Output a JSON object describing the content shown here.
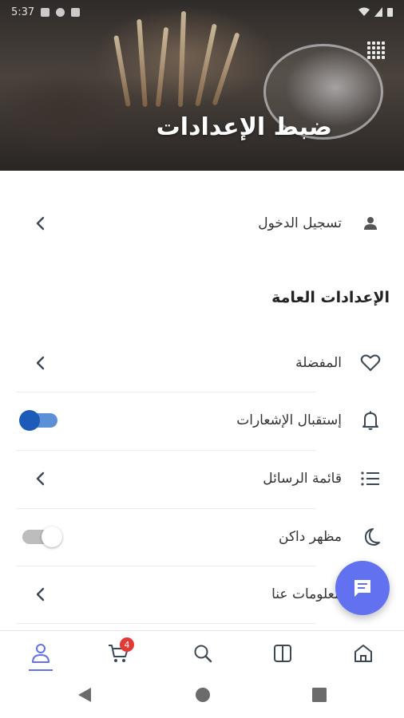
{
  "status_bar": {
    "time": "5:37"
  },
  "header": {
    "title": "ضبط الإعدادات"
  },
  "account": {
    "login_label": "تسجيل الدخول"
  },
  "general_settings": {
    "section_title": "الإعدادات العامة",
    "items": [
      {
        "label": "المفضلة",
        "icon": "heart-icon",
        "trailing": "chevron"
      },
      {
        "label": "إستقبال الإشعارات",
        "icon": "bell-icon",
        "trailing": "toggle",
        "enabled": true
      },
      {
        "label": "قائمة الرسائل",
        "icon": "list-icon",
        "trailing": "chevron"
      },
      {
        "label": "مظهر داكن",
        "icon": "moon-icon",
        "trailing": "toggle",
        "enabled": false
      },
      {
        "label": "معلومات عنا",
        "icon": "info-icon",
        "trailing": "chevron"
      }
    ]
  },
  "bottom_nav": {
    "cart_badge": "4",
    "items": [
      "profile-icon",
      "cart-icon",
      "search-icon",
      "catalog-icon",
      "home-icon"
    ],
    "active": "profile-icon"
  },
  "colors": {
    "accent": "#6171f0",
    "toggle_on": "#1d5bb8",
    "badge": "#e53935"
  }
}
